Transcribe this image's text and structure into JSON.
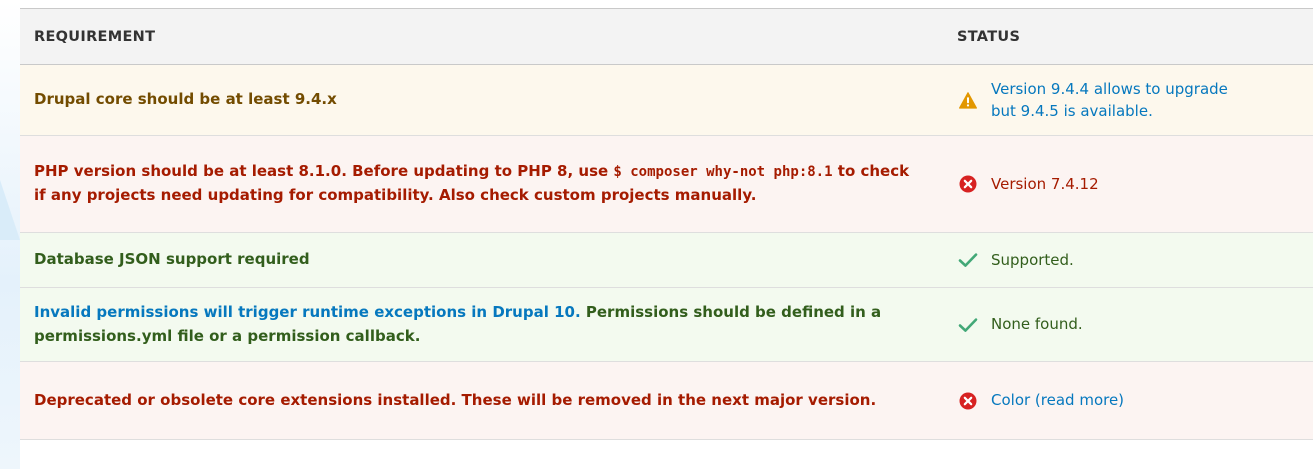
{
  "table": {
    "headers": {
      "requirement": "REQUIREMENT",
      "status": "STATUS"
    },
    "rows": [
      {
        "severity": "warning",
        "requirement": "Drupal core should be at least 9.4.x",
        "status_icon": "warning-triangle-icon",
        "status_line1": "Version 9.4.4 allows to upgrade",
        "status_line2": "but 9.4.5 is available."
      },
      {
        "severity": "error",
        "req_before": "PHP version should be at least 8.1.0. Before updating to PHP 8, use ",
        "req_code": "$ composer why-not php:8.1",
        "req_after": " to check if any projects need updating for compatibility. Also check custom projects manually.",
        "status_icon": "error-circle-icon",
        "status": "Version 7.4.12"
      },
      {
        "severity": "ok",
        "requirement": "Database JSON support required",
        "status_icon": "checkmark-icon",
        "status": "Supported."
      },
      {
        "severity": "ok",
        "req_link": "Invalid permissions will trigger runtime exceptions in Drupal 10.",
        "req_after": " Permissions should be defined in a permissions.yml file or a permission callback.",
        "status_icon": "checkmark-icon",
        "status": "None found."
      },
      {
        "severity": "error",
        "requirement": "Deprecated or obsolete core extensions installed. These will be removed in the next major version.",
        "status_icon": "error-circle-icon",
        "status": "Color (read more)"
      }
    ]
  },
  "colors": {
    "warning_bg": "#fdf8ed",
    "warning_text": "#734c00",
    "warning_icon": "#e29700",
    "error_bg": "#fcf4f2",
    "error_text": "#a51b00",
    "error_icon": "#d72222",
    "ok_bg": "#f3faef",
    "ok_text": "#325e1c",
    "ok_icon": "#42a877",
    "link": "#0678be",
    "header_bg": "#f3f3f3"
  }
}
